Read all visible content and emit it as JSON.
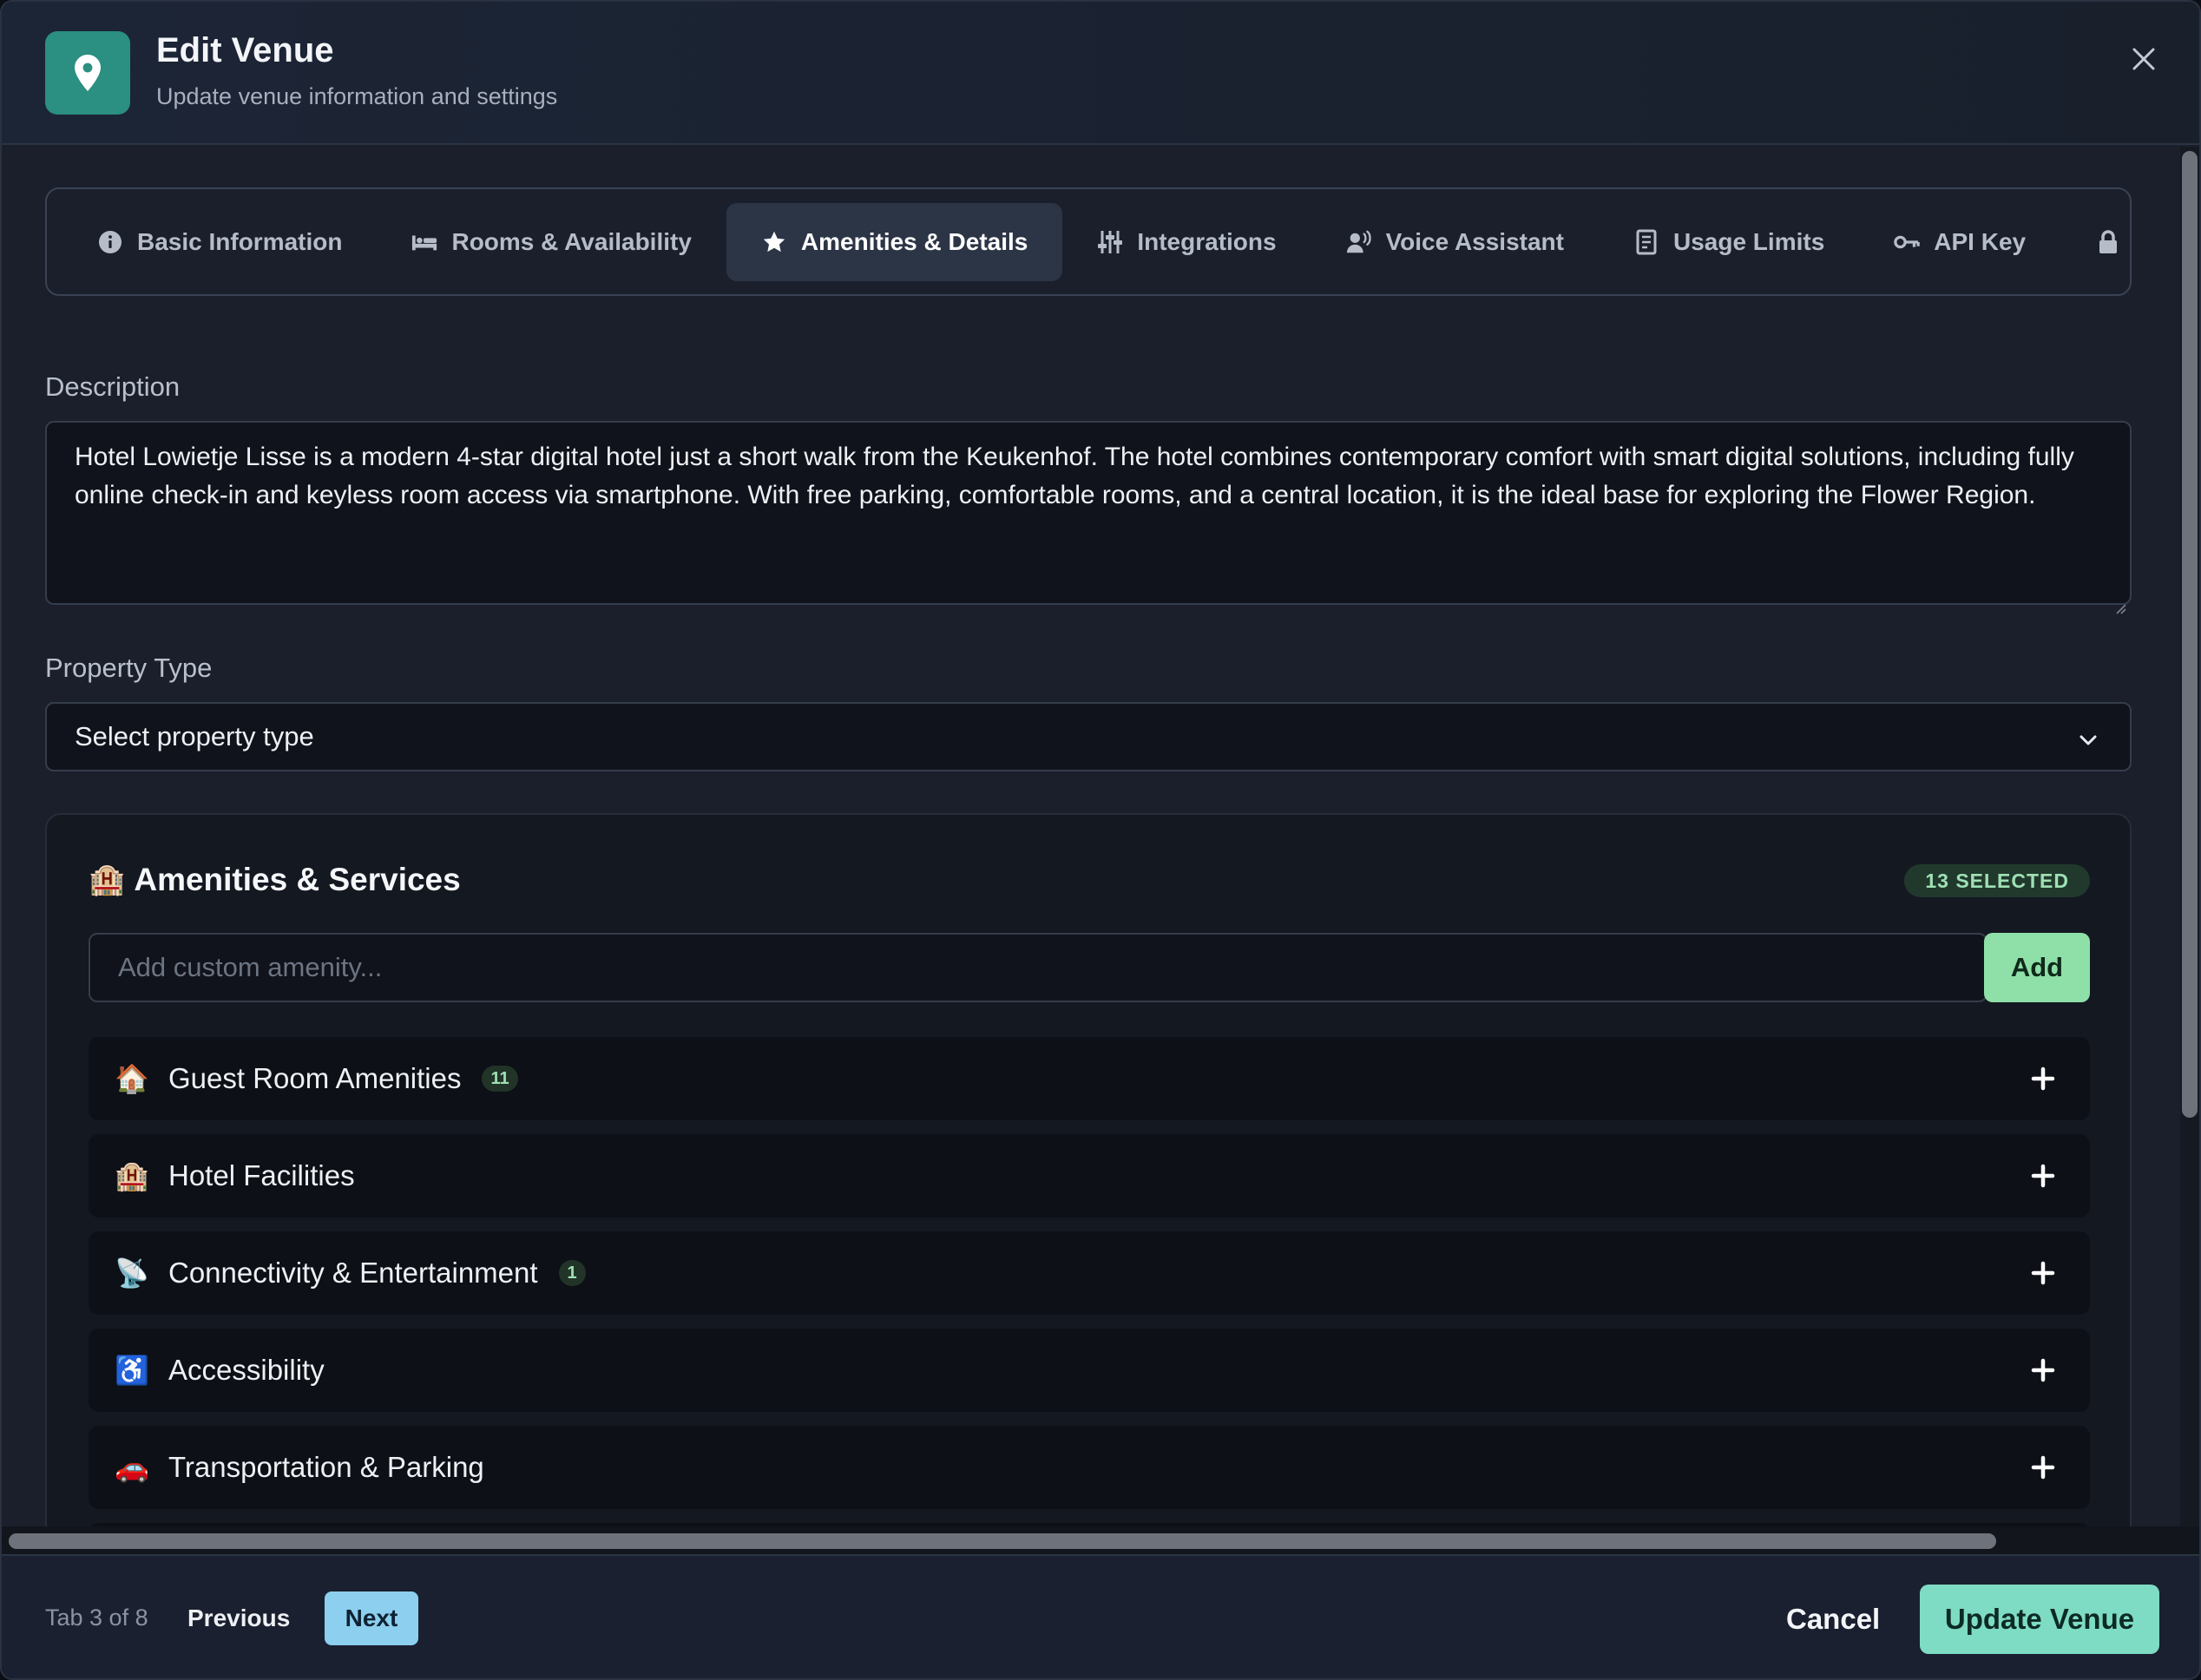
{
  "header": {
    "title": "Edit Venue",
    "subtitle": "Update venue information and settings",
    "icon": "map-pin-icon",
    "accent_color": "#2b8f82"
  },
  "tabs": [
    {
      "label": "Basic Information",
      "icon": "info-icon",
      "active": false
    },
    {
      "label": "Rooms & Availability",
      "icon": "bed-icon",
      "active": false
    },
    {
      "label": "Amenities & Details",
      "icon": "star-icon",
      "active": true
    },
    {
      "label": "Integrations",
      "icon": "sliders-icon",
      "active": false
    },
    {
      "label": "Voice Assistant",
      "icon": "voice-icon",
      "active": false
    },
    {
      "label": "Usage Limits",
      "icon": "receipt-icon",
      "active": false
    },
    {
      "label": "API Key",
      "icon": "key-icon",
      "active": false
    },
    {
      "label": "",
      "icon": "lock-icon",
      "active": false
    }
  ],
  "description": {
    "label": "Description",
    "value": "Hotel Lowietje Lisse is a modern 4-star digital hotel just a short walk from the Keukenhof. The hotel combines contemporary comfort with smart digital solutions, including fully online check-in and keyless room access via smartphone. With free parking, comfortable rooms, and a central location, it is the ideal base for exploring the Flower Region."
  },
  "property_type": {
    "label": "Property Type",
    "value": "Select property type"
  },
  "amenities": {
    "emoji": "🏨",
    "title": "Amenities & Services",
    "selected_badge": "13 SELECTED",
    "custom_placeholder": "Add custom amenity...",
    "add_label": "Add",
    "categories": [
      {
        "emoji": "🏠",
        "label": "Guest Room Amenities",
        "count": "11"
      },
      {
        "emoji": "🏨",
        "label": "Hotel Facilities",
        "count": ""
      },
      {
        "emoji": "📡",
        "label": "Connectivity & Entertainment",
        "count": "1"
      },
      {
        "emoji": "♿",
        "label": "Accessibility",
        "count": ""
      },
      {
        "emoji": "🚗",
        "label": "Transportation & Parking",
        "count": ""
      }
    ]
  },
  "footer": {
    "tab_position": "Tab 3 of 8",
    "previous_label": "Previous",
    "next_label": "Next",
    "cancel_label": "Cancel",
    "update_label": "Update Venue"
  }
}
